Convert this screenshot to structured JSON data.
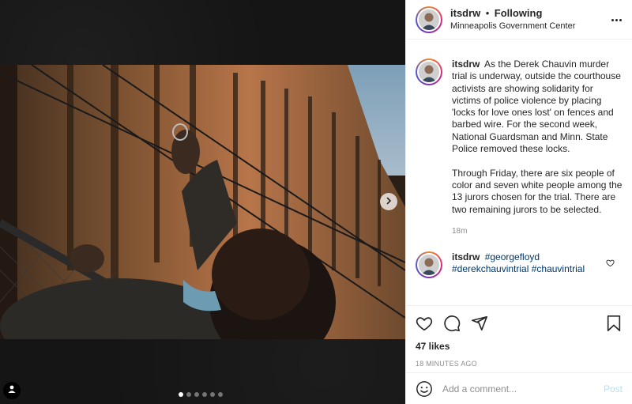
{
  "media": {
    "slide_count": 6,
    "active_slide": 1,
    "next_icon": "chevron-right-icon",
    "tag_icon": "person-icon"
  },
  "post": {
    "author": "itsdrw",
    "follow_separator": "•",
    "follow_status": "Following",
    "location": "Minneapolis Government Center",
    "caption_paragraphs": [
      "As the Derek Chauvin murder trial is underway, outside the courthouse activists are showing solidarity for victims of police violence by placing 'locks for love ones lost' on fences and barbed wire. For the second week, National Guardsman and Minn. State Police removed these locks.",
      "Through Friday, there are six people of color and seven white people among the 13 jurors chosen for the trial. There are two remaining jurors to be selected."
    ],
    "caption_age": "18m",
    "second_comment": {
      "author": "itsdrw",
      "tags": [
        "#georgefloyd",
        "#derekchauvintrial",
        "#chauvintrial"
      ]
    },
    "likes": "47 likes",
    "timestamp": "18 MINUTES AGO"
  },
  "comment_box": {
    "placeholder": "Add a comment...",
    "post_label": "Post"
  },
  "colors": {
    "link": "#00376b",
    "muted": "#8e8e8e",
    "post_disabled": "#b2dffc"
  }
}
